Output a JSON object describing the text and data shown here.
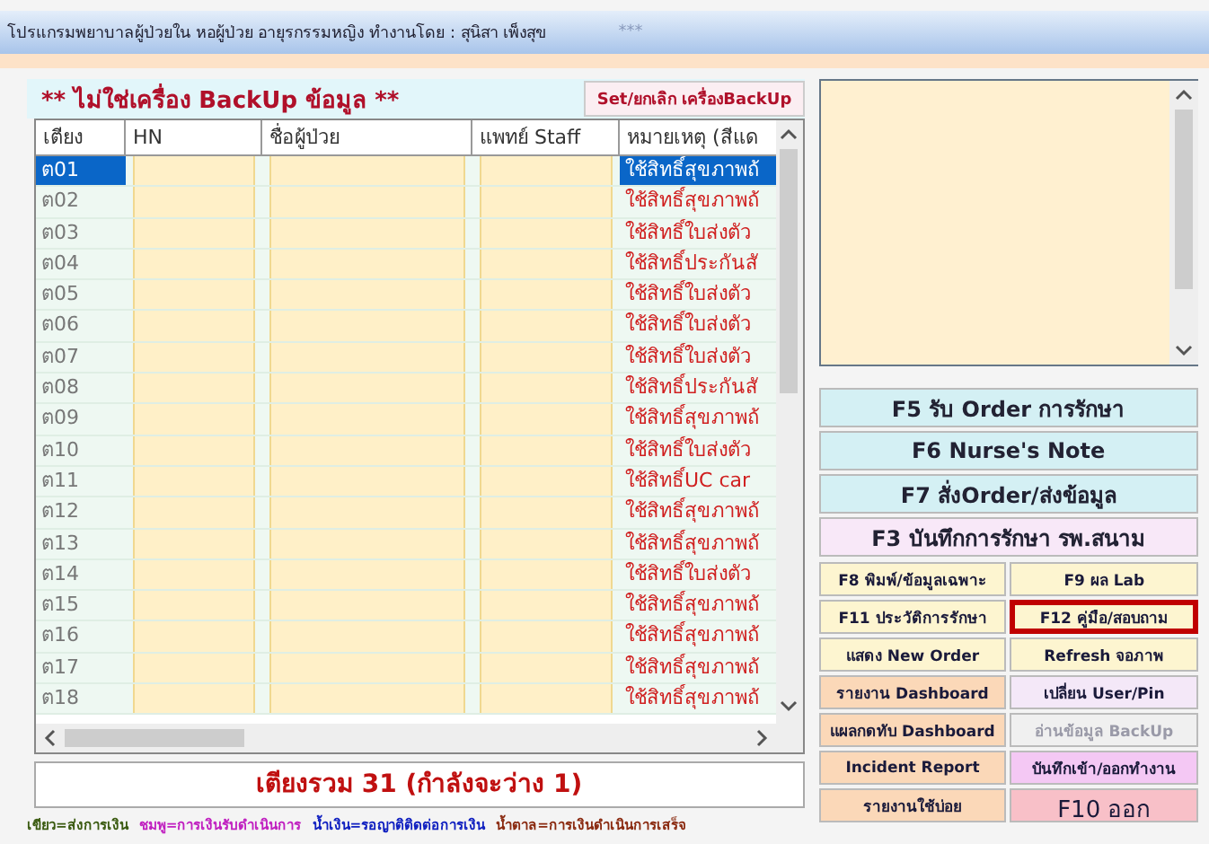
{
  "window": {
    "title": "โปรแกรมพยาบาลผู้ป่วยใน หอผู้ป่วย อายุรกรรมหญิง ทำงานโดย : สุนิสา เพ็งสุข",
    "dots": "***"
  },
  "banner": {
    "text": "** ไม่ใช่เครื่อง BackUp ข้อมูล **",
    "button": "Set/ยกเลิก เครื่องBackUp"
  },
  "table": {
    "columns": [
      "เตียง",
      "HN",
      "ชื่อผู้ป่วย",
      "แพทย์ Staff",
      "หมายเหตุ (สีแด"
    ],
    "rows": [
      {
        "bed": "ต01",
        "note": "ใช้สิทธิ์สุขภาพถ้",
        "selected": true
      },
      {
        "bed": "ต02",
        "note": "ใช้สิทธิ์สุขภาพถ้",
        "selected": false
      },
      {
        "bed": "ต03",
        "note": "ใช้สิทธิ์ใบส่งตัว",
        "selected": false
      },
      {
        "bed": "ต04",
        "note": "ใช้สิทธิ์ประกันสั",
        "selected": false
      },
      {
        "bed": "ต05",
        "note": "ใช้สิทธิ์ใบส่งตัว",
        "selected": false
      },
      {
        "bed": "ต06",
        "note": "ใช้สิทธิ์ใบส่งตัว",
        "selected": false
      },
      {
        "bed": "ต07",
        "note": "ใช้สิทธิ์ใบส่งตัว",
        "selected": false
      },
      {
        "bed": "ต08",
        "note": "ใช้สิทธิ์ประกันสั",
        "selected": false
      },
      {
        "bed": "ต09",
        "note": "ใช้สิทธิ์สุขภาพถ้",
        "selected": false
      },
      {
        "bed": "ต10",
        "note": "ใช้สิทธิ์ใบส่งตัว",
        "selected": false
      },
      {
        "bed": "ต11",
        "note": "ใช้สิทธิ์UC car",
        "selected": false
      },
      {
        "bed": "ต12",
        "note": "ใช้สิทธิ์สุขภาพถ้",
        "selected": false
      },
      {
        "bed": "ต13",
        "note": "ใช้สิทธิ์สุขภาพถ้",
        "selected": false
      },
      {
        "bed": "ต14",
        "note": "ใช้สิทธิ์ใบส่งตัว",
        "selected": false
      },
      {
        "bed": "ต15",
        "note": "ใช้สิทธิ์สุขภาพถ้",
        "selected": false
      },
      {
        "bed": "ต16",
        "note": "ใช้สิทธิ์สุขภาพถ้",
        "selected": false
      },
      {
        "bed": "ต17",
        "note": "ใช้สิทธิ์สุขภาพถ้",
        "selected": false
      },
      {
        "bed": "ต18",
        "note": "ใช้สิทธิ์สุขภาพถ้",
        "selected": false
      }
    ]
  },
  "total": "เตียงรวม 31 (กำลังจะว่าง 1)",
  "legend": [
    {
      "text": "เขียว=ส่งการเงิน",
      "color": "#3a5a10"
    },
    {
      "text": "ชมพู=การเงินรับดำเนินการ",
      "color": "#c020c0"
    },
    {
      "text": "น้ำเงิน=รอญาติติดต่อการเงิน",
      "color": "#1020c0"
    },
    {
      "text": "น้ำตาล=การเงินดำเนินการเสร็จ",
      "color": "#8a2a10"
    }
  ],
  "main_buttons": [
    {
      "label": "F5 รับ Order การรักษา",
      "color": "#d4f0f4"
    },
    {
      "label": "F6 Nurse's Note",
      "color": "#d4f0f4"
    },
    {
      "label": "F7 สั่งOrder/ส่งข้อมูล",
      "color": "#d4f0f4"
    },
    {
      "label": "F3 บันทึกการรักษา รพ.สนาม",
      "color": "#f8e8f8"
    }
  ],
  "buttons": [
    {
      "label": "F8 พิมพ์/ข้อมูลเฉพาะ",
      "color": "#fdf5d0",
      "disabled": false,
      "highlighted": false
    },
    {
      "label": "F9 ผล Lab",
      "color": "#fdf5d0",
      "disabled": false,
      "highlighted": false
    },
    {
      "label": "F11 ประวัติการรักษา",
      "color": "#fdf5d0",
      "disabled": false,
      "highlighted": false
    },
    {
      "label": "F12 คู่มือ/สอบถาม",
      "color": "#fdf5d0",
      "disabled": false,
      "highlighted": true
    },
    {
      "label": "แสดง New Order",
      "color": "#fdf5d0",
      "disabled": false,
      "highlighted": false
    },
    {
      "label": "Refresh จอภาพ",
      "color": "#fdf5d0",
      "disabled": false,
      "highlighted": false
    },
    {
      "label": "รายงาน Dashboard",
      "color": "#fbd8b8",
      "disabled": false,
      "highlighted": false
    },
    {
      "label": "เปลี่ยน User/Pin",
      "color": "#f4e8f8",
      "disabled": false,
      "highlighted": false
    },
    {
      "label": "แผลกดทับ Dashboard",
      "color": "#fbd8b8",
      "disabled": false,
      "highlighted": false
    },
    {
      "label": "อ่านข้อมูล BackUp",
      "color": "#f0f0f0",
      "disabled": true,
      "highlighted": false
    },
    {
      "label": "Incident Report",
      "color": "#fbd8b8",
      "disabled": false,
      "highlighted": false
    },
    {
      "label": "บันทึกเข้า/ออกทำงาน",
      "color": "#f4c8f4",
      "disabled": false,
      "highlighted": false
    },
    {
      "label": "รายงานใช้บ่อย",
      "color": "#fbd8b8",
      "disabled": false,
      "highlighted": false
    },
    {
      "label": "F10 ออก",
      "color": "#f8c0c8",
      "disabled": false,
      "highlighted": false
    }
  ]
}
